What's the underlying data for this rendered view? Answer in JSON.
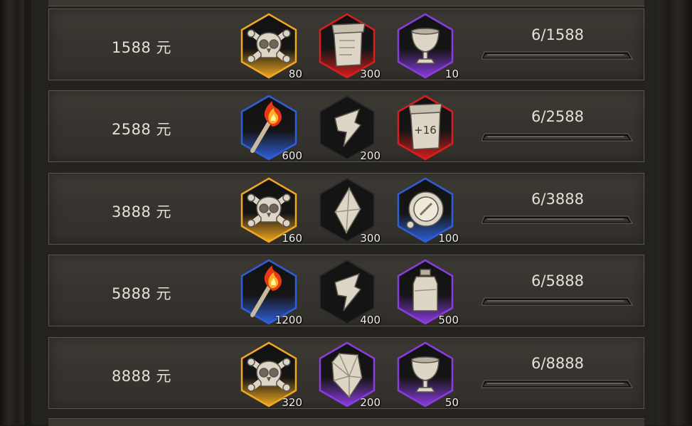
{
  "rows": [
    {
      "price": "1588 元",
      "progress": "6/1588",
      "items": [
        {
          "icon": "skull-icon",
          "frame": "gold",
          "qty": "80"
        },
        {
          "icon": "scroll-icon",
          "frame": "red",
          "qty": "300"
        },
        {
          "icon": "chalice-icon",
          "frame": "purple",
          "qty": "10"
        }
      ]
    },
    {
      "price": "2588 元",
      "progress": "6/2588",
      "items": [
        {
          "icon": "torch-icon",
          "frame": "blue",
          "qty": "600"
        },
        {
          "icon": "shard-icon",
          "frame": "black",
          "qty": "200"
        },
        {
          "icon": "scroll-plus16-icon",
          "frame": "red",
          "qty": ""
        }
      ]
    },
    {
      "price": "3888 元",
      "progress": "6/3888",
      "items": [
        {
          "icon": "skull-icon",
          "frame": "gold",
          "qty": "160"
        },
        {
          "icon": "crystal-icon",
          "frame": "black",
          "qty": "300"
        },
        {
          "icon": "compass-icon",
          "frame": "blue",
          "qty": "100"
        }
      ]
    },
    {
      "price": "5888 元",
      "progress": "6/5888",
      "items": [
        {
          "icon": "torch-icon",
          "frame": "blue",
          "qty": "1200"
        },
        {
          "icon": "shard-icon",
          "frame": "black",
          "qty": "400"
        },
        {
          "icon": "jar-icon",
          "frame": "purple",
          "qty": "500"
        }
      ]
    },
    {
      "price": "8888 元",
      "progress": "6/8888",
      "items": [
        {
          "icon": "skull-icon",
          "frame": "gold",
          "qty": "320"
        },
        {
          "icon": "gem-icon",
          "frame": "purple",
          "qty": "200"
        },
        {
          "icon": "chalice-icon",
          "frame": "purple",
          "qty": "50"
        }
      ]
    }
  ],
  "scroll_plus_label": "+16",
  "colors": {
    "gold": "#f0a820",
    "red": "#d81e1e",
    "purple": "#8a3ce0",
    "blue": "#2f5fd8",
    "black": "#1a1a1a",
    "text": "#e4e0d8"
  }
}
